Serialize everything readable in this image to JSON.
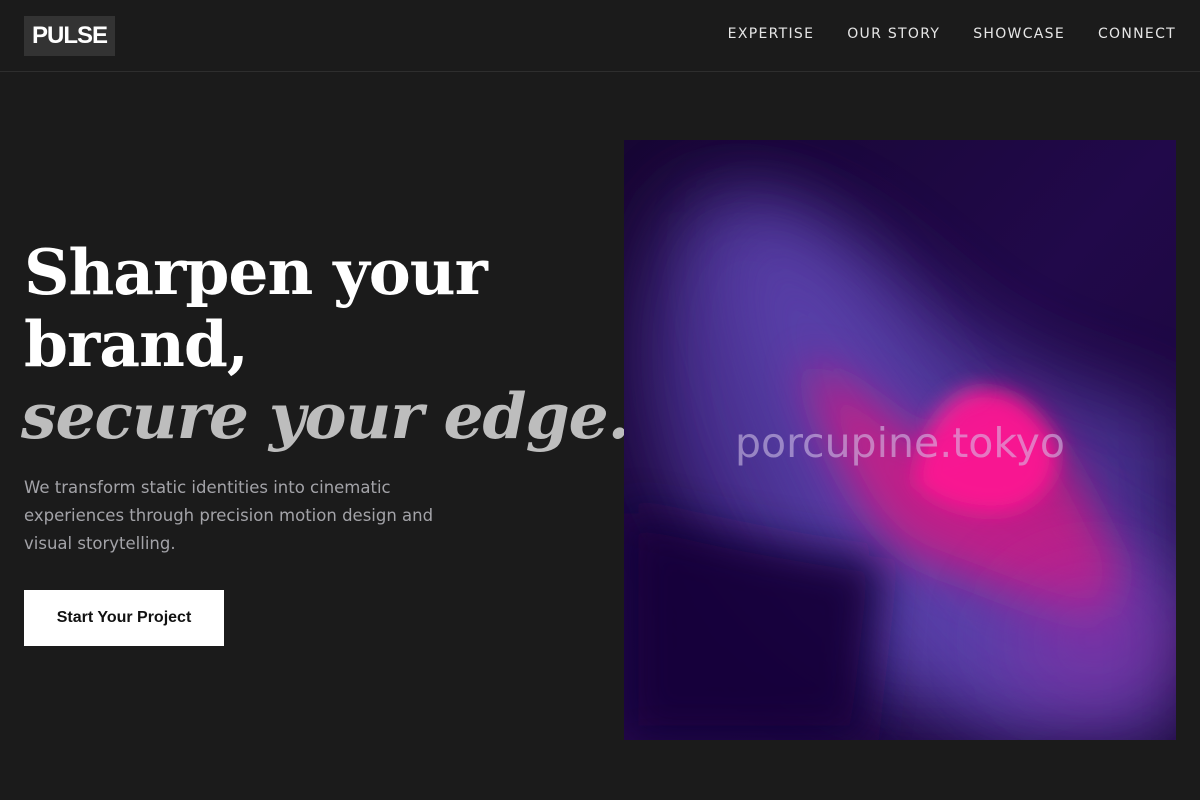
{
  "header": {
    "logo_text": "PULSE",
    "nav": [
      {
        "label": "EXPERTISE"
      },
      {
        "label": "OUR STORY"
      },
      {
        "label": "SHOWCASE"
      },
      {
        "label": "CONNECT"
      }
    ]
  },
  "hero": {
    "headline_line1": "Sharpen your",
    "headline_line2": "brand,",
    "headline_accent": "secure your edge.",
    "description": "We transform static identities into cinematic experiences through precision motion design and visual storytelling.",
    "cta_label": "Start Your Project",
    "image_watermark": "porcupine.tokyo"
  },
  "colors": {
    "background": "#1b1b1b",
    "logo_bg": "#333333",
    "accent_text": "#bdbdbd",
    "cta_bg": "#ffffff",
    "image_base": "#1a0838",
    "image_violet": "#5b3ea6",
    "image_pink": "#ff1493"
  }
}
